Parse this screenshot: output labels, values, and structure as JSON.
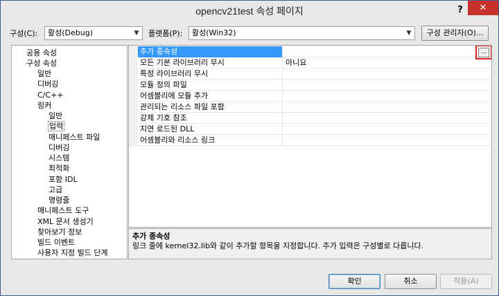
{
  "window": {
    "title": "opencv21test 속성 페이지",
    "help_glyph": "?",
    "close_glyph": "✕"
  },
  "config": {
    "config_label": "구성(C):",
    "config_value": "활성(Debug)",
    "platform_label": "플랫폼(P):",
    "platform_value": "활성(Win32)",
    "manager_button": "구성 관리자(O)..."
  },
  "tree": {
    "items": [
      {
        "label": "공용 속성"
      },
      {
        "label": "구성 속성"
      },
      {
        "label": "일반"
      },
      {
        "label": "디버깅"
      },
      {
        "label": "C/C++"
      },
      {
        "label": "링커"
      },
      {
        "label": "일반"
      },
      {
        "label": "입력"
      },
      {
        "label": "매니페스트 파일"
      },
      {
        "label": "디버깅"
      },
      {
        "label": "시스템"
      },
      {
        "label": "최적화"
      },
      {
        "label": "포함 IDL"
      },
      {
        "label": "고급"
      },
      {
        "label": "명령줄"
      },
      {
        "label": "매니페스트 도구"
      },
      {
        "label": "XML 문서 생성기"
      },
      {
        "label": "찾아보기 정보"
      },
      {
        "label": "빌드 이벤트"
      },
      {
        "label": "사용자 지정 빌드 단계"
      }
    ]
  },
  "grid": {
    "rows": [
      {
        "name": "추가 종속성",
        "value": ""
      },
      {
        "name": "모든 기본 라이브러리 무시",
        "value": "아니요"
      },
      {
        "name": "특정 라이브러리 무시",
        "value": ""
      },
      {
        "name": "모듈 정의 파일",
        "value": ""
      },
      {
        "name": "어셈블리에 모듈 추가",
        "value": ""
      },
      {
        "name": "관리되는 리소스 파일 포함",
        "value": ""
      },
      {
        "name": "강제 기호 참조",
        "value": ""
      },
      {
        "name": "지연 로드된 DLL",
        "value": ""
      },
      {
        "name": "어셈블리와 리소스 링크",
        "value": ""
      }
    ],
    "ellipsis": "..."
  },
  "description": {
    "title": "추가 종속성",
    "text": "링크 줄에 kernel32.lib와 같이 추가할 항목을 지정합니다. 추가 입력은 구성별로 다릅니다."
  },
  "buttons": {
    "ok": "확인",
    "cancel": "취소",
    "apply": "적용(A)"
  },
  "colors": {
    "selection": "#3399ff",
    "highlight": "#e02020",
    "close": "#c7312b"
  }
}
